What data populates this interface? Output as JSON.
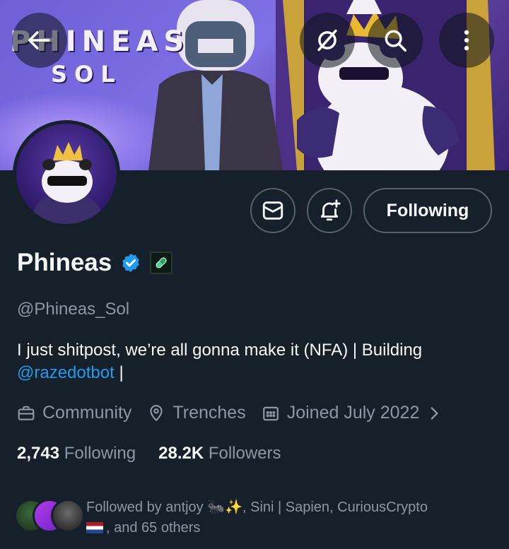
{
  "banner": {
    "logo_line1": "PHINEAS",
    "logo_line2": "SOL"
  },
  "actions": {
    "following_label": "Following"
  },
  "profile": {
    "name": "Phineas",
    "handle": "@Phineas_Sol",
    "bio_text": "I just shitpost, we’re all gonna make it (NFA) | Building",
    "bio_mention": "@razedotbot",
    "bio_suffix": " |"
  },
  "meta": {
    "category": "Community",
    "location": "Trenches",
    "joined": "Joined July 2022"
  },
  "counts": {
    "following_num": "2,743",
    "following_label": "Following",
    "followers_num": "28.2K",
    "followers_label": "Followers"
  },
  "followed_by": {
    "line1": "Followed by antjoy 🐜✨, Sini | Sapien, CuriousCrypto",
    "line2": ", and 65 others"
  },
  "colors": {
    "background": "#15202b",
    "accent": "#1d9bf0",
    "muted": "#8b98a5",
    "border": "#536471"
  },
  "icons": [
    "back-arrow-icon",
    "grok-icon",
    "search-icon",
    "more-icon",
    "message-icon",
    "bell-plus-icon",
    "verified-badge-icon",
    "affiliate-badge-icon",
    "briefcase-icon",
    "location-pin-icon",
    "calendar-icon",
    "chevron-right-icon"
  ]
}
